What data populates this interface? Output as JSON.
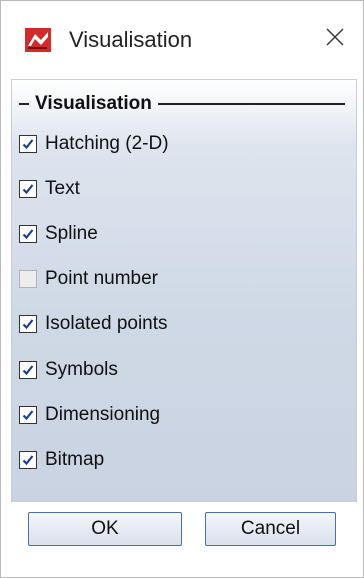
{
  "window": {
    "title": "Visualisation",
    "icon": "hicad-app-icon",
    "close_icon": "close-icon"
  },
  "group": {
    "title": "Visualisation"
  },
  "options": [
    {
      "label": "Hatching (2-D)",
      "checked": true
    },
    {
      "label": "Text",
      "checked": true
    },
    {
      "label": "Spline",
      "checked": true
    },
    {
      "label": "Point number",
      "checked": false
    },
    {
      "label": "Isolated points",
      "checked": true
    },
    {
      "label": "Symbols",
      "checked": true
    },
    {
      "label": "Dimensioning",
      "checked": true
    },
    {
      "label": "Bitmap",
      "checked": true
    }
  ],
  "buttons": {
    "ok_label": "OK",
    "cancel_label": "Cancel"
  },
  "colors": {
    "panel_gradient_top": "#dde4ee",
    "panel_gradient_bottom": "#c9d3e1",
    "button_border": "#4b6fa8",
    "check_color": "#1a3f8f"
  }
}
